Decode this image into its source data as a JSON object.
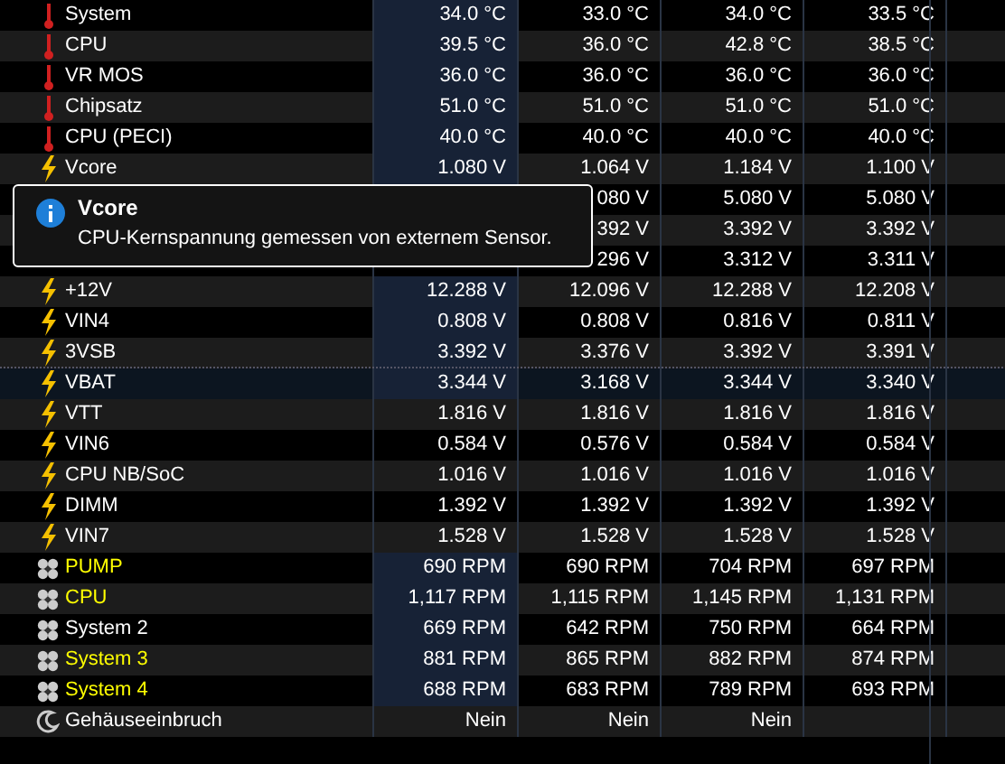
{
  "rows": [
    {
      "kind": "temperature",
      "label": "System",
      "cells": {
        "column_1": "34.0 °C",
        "column_2": "33.0 °C",
        "column_3": "34.0 °C",
        "column_4": "33.5 °C"
      },
      "highlighted": true,
      "selected": false
    },
    {
      "kind": "temperature",
      "label": "CPU",
      "cells": {
        "column_1": "39.5 °C",
        "column_2": "36.0 °C",
        "column_3": "42.8 °C",
        "column_4": "38.5 °C"
      },
      "highlighted": true,
      "selected": false
    },
    {
      "kind": "temperature",
      "label": "VR MOS",
      "cells": {
        "column_1": "36.0 °C",
        "column_2": "36.0 °C",
        "column_3": "36.0 °C",
        "column_4": "36.0 °C"
      },
      "highlighted": true,
      "selected": false
    },
    {
      "kind": "temperature",
      "label": "Chipsatz",
      "cells": {
        "column_1": "51.0 °C",
        "column_2": "51.0 °C",
        "column_3": "51.0 °C",
        "column_4": "51.0 °C"
      },
      "highlighted": true,
      "selected": false
    },
    {
      "kind": "temperature",
      "label": "CPU (PECI)",
      "cells": {
        "column_1": "40.0 °C",
        "column_2": "40.0 °C",
        "column_3": "40.0 °C",
        "column_4": "40.0 °C"
      },
      "highlighted": true,
      "selected": false
    },
    {
      "kind": "voltage",
      "label": "Vcore",
      "cells": {
        "column_1": "1.080 V",
        "column_2": "1.064 V",
        "column_3": "1.184 V",
        "column_4": "1.100 V"
      },
      "highlighted": true,
      "selected": false
    },
    {
      "cells": {
        "column_2": "080 V",
        "column_3": "5.080 V",
        "column_4": "5.080 V"
      },
      "selected": false
    },
    {
      "cells": {
        "column_2": "392 V",
        "column_3": "3.392 V",
        "column_4": "3.392 V"
      },
      "selected": false
    },
    {
      "cells": {
        "column_2": "296 V",
        "column_3": "3.312 V",
        "column_4": "3.311 V"
      },
      "selected": false
    },
    {
      "kind": "voltage",
      "label": "+12V",
      "cells": {
        "column_1": "12.288 V",
        "column_2": "12.096 V",
        "column_3": "12.288 V",
        "column_4": "12.208 V"
      },
      "highlighted": true,
      "selected": false
    },
    {
      "kind": "voltage",
      "label": "VIN4",
      "cells": {
        "column_1": "0.808 V",
        "column_2": "0.808 V",
        "column_3": "0.816 V",
        "column_4": "0.811 V"
      },
      "highlighted": true,
      "selected": false
    },
    {
      "kind": "voltage",
      "label": "3VSB",
      "cells": {
        "column_1": "3.392 V",
        "column_2": "3.376 V",
        "column_3": "3.392 V",
        "column_4": "3.391 V"
      },
      "highlighted": true,
      "selected": false
    },
    {
      "kind": "voltage",
      "label": "VBAT",
      "cells": {
        "column_1": "3.344 V",
        "column_2": "3.168 V",
        "column_3": "3.344 V",
        "column_4": "3.340 V"
      },
      "highlighted": true,
      "selected": true
    },
    {
      "kind": "voltage",
      "label": "VTT",
      "cells": {
        "column_1": "1.816 V",
        "column_2": "1.816 V",
        "column_3": "1.816 V",
        "column_4": "1.816 V"
      },
      "highlighted": false,
      "selected": false
    },
    {
      "kind": "voltage",
      "label": "VIN6",
      "cells": {
        "column_1": "0.584 V",
        "column_2": "0.576 V",
        "column_3": "0.584 V",
        "column_4": "0.584 V"
      },
      "highlighted": false,
      "selected": false
    },
    {
      "kind": "voltage",
      "label": "CPU NB/SoC",
      "cells": {
        "column_1": "1.016 V",
        "column_2": "1.016 V",
        "column_3": "1.016 V",
        "column_4": "1.016 V"
      },
      "highlighted": false,
      "selected": false
    },
    {
      "kind": "voltage",
      "label": "DIMM",
      "cells": {
        "column_1": "1.392 V",
        "column_2": "1.392 V",
        "column_3": "1.392 V",
        "column_4": "1.392 V"
      },
      "highlighted": false,
      "selected": false
    },
    {
      "kind": "voltage",
      "label": "VIN7",
      "cells": {
        "column_1": "1.528 V",
        "column_2": "1.528 V",
        "column_3": "1.528 V",
        "column_4": "1.528 V"
      },
      "highlighted": false,
      "selected": false
    },
    {
      "kind": "fan",
      "label": "PUMP",
      "color": "#ffff00",
      "cells": {
        "column_1": "690 RPM",
        "column_2": "690 RPM",
        "column_3": "704 RPM",
        "column_4": "697 RPM"
      },
      "highlighted": true,
      "selected": false
    },
    {
      "kind": "fan",
      "label": "CPU",
      "color": "#ffff00",
      "cells": {
        "column_1": "1,117 RPM",
        "column_2": "1,115 RPM",
        "column_3": "1,145 RPM",
        "column_4": "1,131 RPM"
      },
      "highlighted": true,
      "selected": false
    },
    {
      "kind": "fan",
      "label": "System 2",
      "color": "#ffffff",
      "cells": {
        "column_1": "669 RPM",
        "column_2": "642 RPM",
        "column_3": "750 RPM",
        "column_4": "664 RPM"
      },
      "highlighted": true,
      "selected": false
    },
    {
      "kind": "fan",
      "label": "System 3",
      "color": "#ffff00",
      "cells": {
        "column_1": "881 RPM",
        "column_2": "865 RPM",
        "column_3": "882 RPM",
        "column_4": "874 RPM"
      },
      "highlighted": true,
      "selected": false
    },
    {
      "kind": "fan",
      "label": "System 4",
      "color": "#ffff00",
      "cells": {
        "column_1": "688 RPM",
        "column_2": "683 RPM",
        "column_3": "789 RPM",
        "column_4": "693 RPM"
      },
      "highlighted": true,
      "selected": false
    },
    {
      "kind": "intrusion",
      "label": "Gehäuseeinbruch",
      "cells": {
        "column_1": "Nein",
        "column_2": "Nein",
        "column_3": "Nein"
      },
      "highlighted": false,
      "selected": false
    }
  ],
  "tooltip": {
    "title": "Vcore",
    "text": "CPU-Kernspannung gemessen von externem Sensor."
  }
}
